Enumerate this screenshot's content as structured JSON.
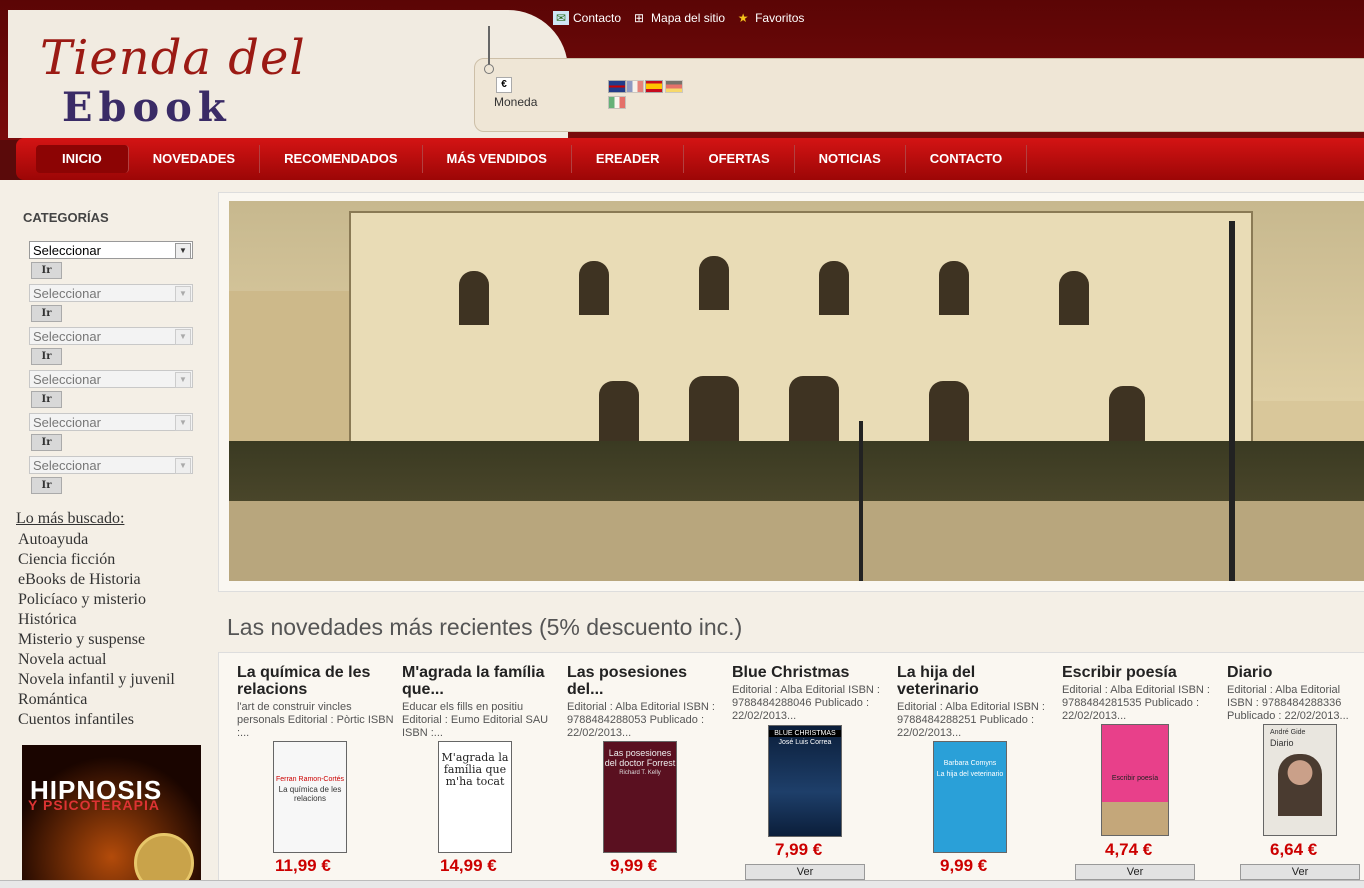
{
  "header": {
    "logo_line1": "Tienda del",
    "logo_line2": "Ebook",
    "top_links": [
      {
        "label": "Contacto",
        "icon": "envelope-icon"
      },
      {
        "label": "Mapa del sitio",
        "icon": "sitemap-icon"
      },
      {
        "label": "Favoritos",
        "icon": "star-icon"
      }
    ],
    "currency_symbol": "€",
    "currency_label": "Moneda"
  },
  "nav": [
    "INICIO",
    "NOVEDADES",
    "RECOMENDADOS",
    "MÁS VENDIDOS",
    "EREADER",
    "OFERTAS",
    "NOTICIAS",
    "CONTACTO"
  ],
  "sidebar": {
    "categories_title": "CATEGORÍAS",
    "select_placeholder": "Seleccionar",
    "go_button": "Ir",
    "lomas_title": "Lo más buscado:",
    "searches": [
      "Autoayuda",
      "Ciencia ficción",
      "eBooks de Historia",
      "Policíaco y misterio",
      "Histórica",
      "Misterio y suspense",
      "Novela actual",
      "Novela infantil y juvenil",
      "Romántica",
      "Cuentos infantiles"
    ],
    "banner_title": "HIPNOSIS",
    "banner_subtitle": "Y PSICOTERAPIA"
  },
  "section_title": "Las novedades más recientes (5% descuento inc.)",
  "products": [
    {
      "title": "La química de les relacions",
      "desc": "l'art de construir vincles personals Editorial : Pòrtic ISBN :...",
      "price": "11,99 €",
      "cover_text": "La química de les relacions",
      "cover_author": "Ferran Ramon-Cortés",
      "cover_bg": "#f7f7f7",
      "has_ver": false
    },
    {
      "title": "M'agrada la família que...",
      "desc": "Educar els fills en positiu Editorial : Eumo Editorial SAU ISBN :...",
      "price": "14,99 €",
      "cover_text": "M'agrada la família que m'ha tocat",
      "cover_author": "",
      "cover_bg": "#ffffff",
      "has_ver": false
    },
    {
      "title": "Las posesiones del...",
      "desc": "Editorial : Alba Editorial ISBN : 9788484288053 Publicado : 22/02/2013...",
      "price": "9,99 €",
      "cover_text": "Las posesiones del doctor Forrest",
      "cover_author": "Richard T. Kelly",
      "cover_bg": "#5a1020",
      "has_ver": false
    },
    {
      "title": "Blue Christmas",
      "desc": "Editorial : Alba Editorial ISBN : 9788484288046 Publicado : 22/02/2013...",
      "price": "7,99 €",
      "cover_text": "BLUE CHRISTMAS",
      "cover_author": "José Luis Correa",
      "cover_bg": "#0b1e3a",
      "has_ver": true
    },
    {
      "title": "La hija del veterinario",
      "desc": "Editorial : Alba Editorial ISBN : 9788484288251 Publicado : 22/02/2013...",
      "price": "9,99 €",
      "cover_text": "La hija del veterinario",
      "cover_author": "Barbara Comyns",
      "cover_bg": "#2aa0d8",
      "has_ver": false
    },
    {
      "title": "Escribir poesía",
      "desc": "Editorial : Alba Editorial ISBN : 9788484281535 Publicado : 22/02/2013...",
      "price": "4,74 €",
      "cover_text": "Escribir poesía",
      "cover_author": "",
      "cover_bg": "#e8408a",
      "has_ver": true
    },
    {
      "title": "Diario",
      "desc": "Editorial : Alba Editorial ISBN : 9788484288336 Publicado : 22/02/2013...",
      "price": "6,64 €",
      "cover_text": "Diario",
      "cover_author": "André Gide",
      "cover_bg": "#e9e6df",
      "has_ver": true
    }
  ],
  "ver_label": "Ver",
  "colors": {
    "nav_red": "#c40d0d",
    "price_red": "#cc0000",
    "header_dark": "#5b0505"
  }
}
